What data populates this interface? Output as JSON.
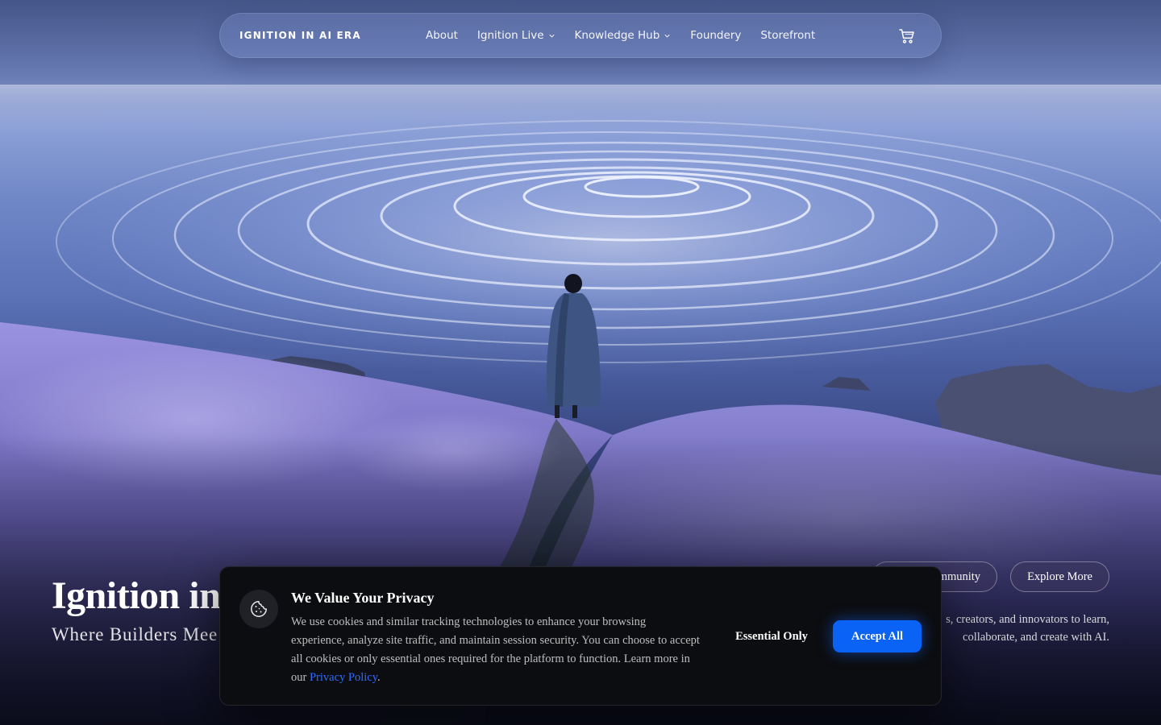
{
  "nav": {
    "brand": "IGNITION IN AI ERA",
    "links": [
      {
        "label": "About",
        "has_dropdown": false
      },
      {
        "label": "Ignition Live",
        "has_dropdown": true
      },
      {
        "label": "Knowledge Hub",
        "has_dropdown": true
      },
      {
        "label": "Foundery",
        "has_dropdown": false
      },
      {
        "label": "Storefront",
        "has_dropdown": false
      }
    ],
    "cart_icon": "shopping-cart-icon"
  },
  "hero": {
    "title": "Ignition in A",
    "subtitle": "Where Builders Mee",
    "cta_community": "mmunity",
    "cta_explore": "Explore More",
    "description": "s, creators, and innovators to learn, collaborate, and create with AI."
  },
  "cookie": {
    "icon": "cookie-icon",
    "title": "We Value Your Privacy",
    "text": "We use cookies and similar tracking technologies to enhance your browsing experience, analyze site traffic, and maintain session security. You can choose to accept all cookies or only essential ones required for the platform to function. Learn more in our ",
    "link_label": "Privacy Policy",
    "text_end": ".",
    "essential_label": "Essential Only",
    "accept_label": "Accept All"
  },
  "colors": {
    "accent": "#0a63f5",
    "link": "#2f6bff",
    "banner_bg": "#0c0d10"
  }
}
